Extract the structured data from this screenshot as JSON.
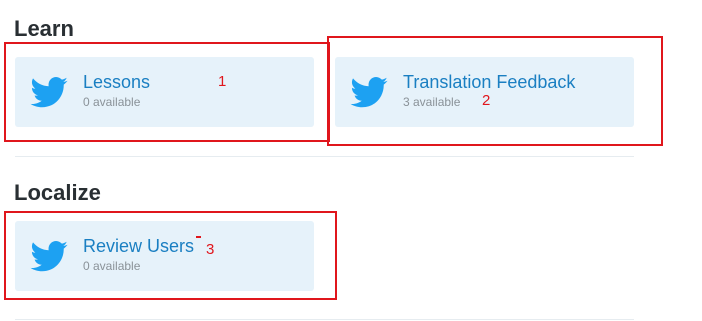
{
  "sections": {
    "learn": {
      "title": "Learn",
      "cards": [
        {
          "title": "Lessons",
          "subtitle": "0 available",
          "icon": "twitter-bird-icon"
        },
        {
          "title": "Translation Feedback",
          "subtitle": "3 available",
          "icon": "twitter-bird-icon"
        }
      ]
    },
    "localize": {
      "title": "Localize",
      "cards": [
        {
          "title": "Review Users",
          "subtitle": "0 available",
          "icon": "twitter-bird-icon"
        }
      ]
    }
  },
  "annotations": [
    "1",
    "2",
    "3"
  ],
  "colors": {
    "card_bg": "#e6f2fa",
    "link": "#1a7fc2",
    "twitter_blue": "#1da1f2",
    "annotation_red": "#e0161c"
  }
}
